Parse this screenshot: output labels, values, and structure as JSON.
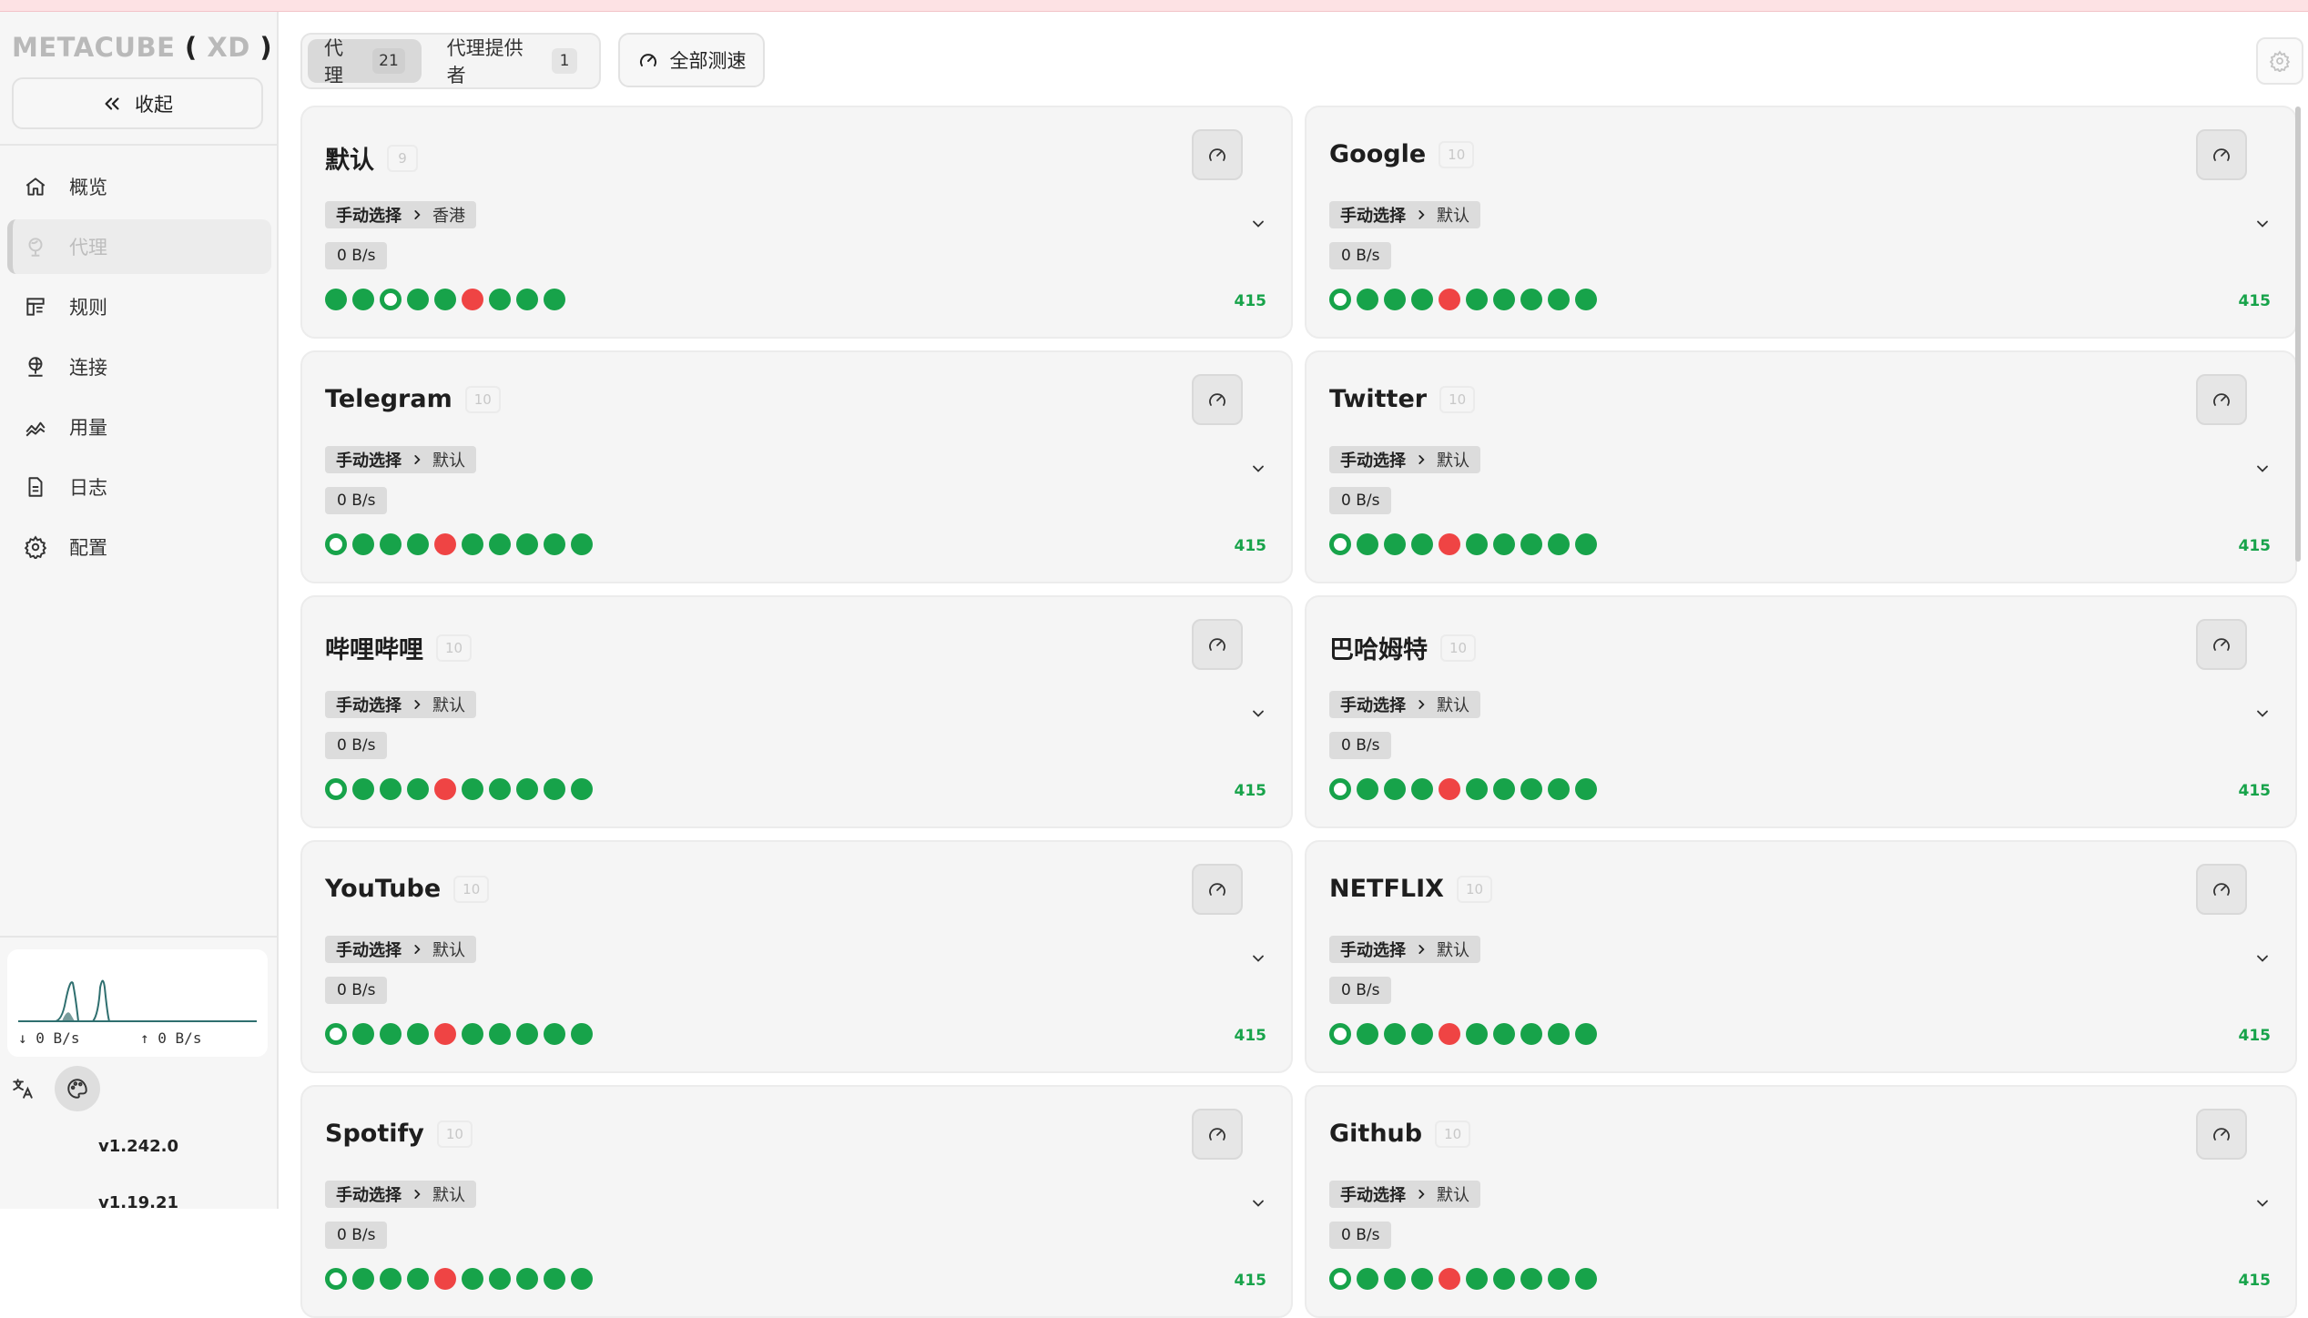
{
  "app": {
    "brand_main": "METACUBE",
    "brand_open": "(",
    "brand_sub": "XD",
    "brand_close": ")",
    "collapse_label": "收起"
  },
  "sidebar": {
    "items": [
      {
        "label": "概览",
        "icon": "home-icon"
      },
      {
        "label": "代理",
        "icon": "globe-icon",
        "active": true
      },
      {
        "label": "规则",
        "icon": "rules-icon"
      },
      {
        "label": "连接",
        "icon": "network-icon"
      },
      {
        "label": "用量",
        "icon": "area-chart-icon"
      },
      {
        "label": "日志",
        "icon": "file-icon"
      },
      {
        "label": "配置",
        "icon": "gear-icon"
      }
    ],
    "download_rate": "0 B/s",
    "upload_rate": "0 B/s",
    "version_ui": "v1.242.0",
    "version_core": "v1.19.21"
  },
  "header": {
    "tabs": [
      {
        "label": "代理",
        "count": "21",
        "active": true
      },
      {
        "label": "代理提供者",
        "count": "1",
        "active": false
      }
    ],
    "test_all_label": "全部测速"
  },
  "groups": [
    {
      "name": "默认",
      "count": "9",
      "type": "手动选择",
      "current": "香港",
      "rate": "0 B/s",
      "latency": "415",
      "dots": [
        "ok",
        "ok",
        "ring",
        "ok",
        "ok",
        "fail",
        "ok",
        "ok",
        "ok"
      ]
    },
    {
      "name": "Google",
      "count": "10",
      "type": "手动选择",
      "current": "默认",
      "rate": "0 B/s",
      "latency": "415",
      "dots": [
        "ring",
        "ok",
        "ok",
        "ok",
        "fail",
        "ok",
        "ok",
        "ok",
        "ok",
        "ok"
      ]
    },
    {
      "name": "Telegram",
      "count": "10",
      "type": "手动选择",
      "current": "默认",
      "rate": "0 B/s",
      "latency": "415",
      "dots": [
        "ring",
        "ok",
        "ok",
        "ok",
        "fail",
        "ok",
        "ok",
        "ok",
        "ok",
        "ok"
      ]
    },
    {
      "name": "Twitter",
      "count": "10",
      "type": "手动选择",
      "current": "默认",
      "rate": "0 B/s",
      "latency": "415",
      "dots": [
        "ring",
        "ok",
        "ok",
        "ok",
        "fail",
        "ok",
        "ok",
        "ok",
        "ok",
        "ok"
      ]
    },
    {
      "name": "哔哩哔哩",
      "count": "10",
      "type": "手动选择",
      "current": "默认",
      "rate": "0 B/s",
      "latency": "415",
      "dots": [
        "ring",
        "ok",
        "ok",
        "ok",
        "fail",
        "ok",
        "ok",
        "ok",
        "ok",
        "ok"
      ]
    },
    {
      "name": "巴哈姆特",
      "count": "10",
      "type": "手动选择",
      "current": "默认",
      "rate": "0 B/s",
      "latency": "415",
      "dots": [
        "ring",
        "ok",
        "ok",
        "ok",
        "fail",
        "ok",
        "ok",
        "ok",
        "ok",
        "ok"
      ]
    },
    {
      "name": "YouTube",
      "count": "10",
      "type": "手动选择",
      "current": "默认",
      "rate": "0 B/s",
      "latency": "415",
      "dots": [
        "ring",
        "ok",
        "ok",
        "ok",
        "fail",
        "ok",
        "ok",
        "ok",
        "ok",
        "ok"
      ]
    },
    {
      "name": "NETFLIX",
      "count": "10",
      "type": "手动选择",
      "current": "默认",
      "rate": "0 B/s",
      "latency": "415",
      "dots": [
        "ring",
        "ok",
        "ok",
        "ok",
        "fail",
        "ok",
        "ok",
        "ok",
        "ok",
        "ok"
      ]
    },
    {
      "name": "Spotify",
      "count": "10",
      "type": "手动选择",
      "current": "默认",
      "rate": "0 B/s",
      "latency": "415",
      "dots": [
        "ring",
        "ok",
        "ok",
        "ok",
        "fail",
        "ok",
        "ok",
        "ok",
        "ok",
        "ok"
      ]
    },
    {
      "name": "Github",
      "count": "10",
      "type": "手动选择",
      "current": "默认",
      "rate": "0 B/s",
      "latency": "415",
      "dots": [
        "ring",
        "ok",
        "ok",
        "ok",
        "fail",
        "ok",
        "ok",
        "ok",
        "ok",
        "ok"
      ]
    }
  ],
  "colors": {
    "ok": "#17a34a",
    "fail": "#ef4444",
    "active_bg": "#ececec"
  }
}
